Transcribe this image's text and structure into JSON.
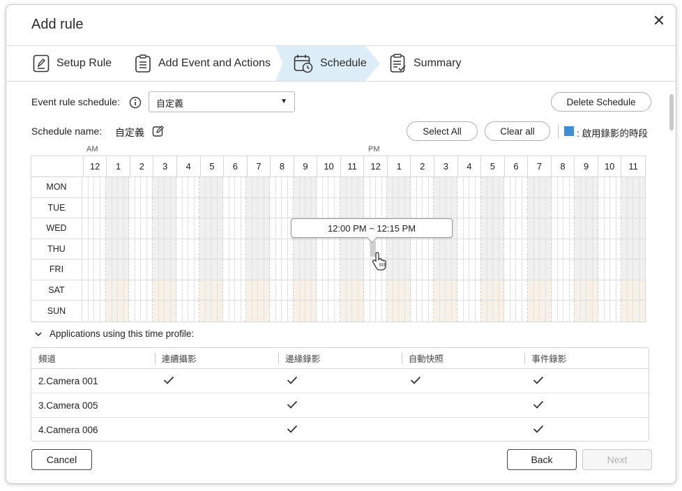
{
  "dialog": {
    "title": "Add rule",
    "close_icon": "close-icon"
  },
  "steps": [
    {
      "label": "Setup Rule",
      "icon": "edit-document-icon"
    },
    {
      "label": "Add Event and Actions",
      "icon": "clipboard-list-icon"
    },
    {
      "label": "Schedule",
      "icon": "calendar-clock-icon",
      "active": true
    },
    {
      "label": "Summary",
      "icon": "checklist-document-icon"
    }
  ],
  "schedule": {
    "rule_schedule_label": "Event rule schedule:",
    "selected": "自定義",
    "delete_label": "Delete Schedule",
    "name_label": "Schedule name:",
    "name_value": "自定義",
    "select_all_label": "Select All",
    "clear_all_label": "Clear all",
    "legend_label": ": 啟用錄影的時段",
    "legend_color": "#3d8ed6",
    "am": "AM",
    "pm": "PM",
    "hours": [
      "12",
      "1",
      "2",
      "3",
      "4",
      "5",
      "6",
      "7",
      "8",
      "9",
      "10",
      "11",
      "12",
      "1",
      "2",
      "3",
      "4",
      "5",
      "6",
      "7",
      "8",
      "9",
      "10",
      "11"
    ],
    "days": [
      "MON",
      "TUE",
      "WED",
      "THU",
      "FRI",
      "SAT",
      "SUN"
    ],
    "tooltip": "12:00 PM ~ 12:15 PM"
  },
  "apps": {
    "header": "Applications using this time profile:",
    "columns": [
      "頻道",
      "連續攝影",
      "邊緣錄影",
      "自動快照",
      "事件錄影"
    ],
    "rows": [
      {
        "name": "2.Camera 001",
        "checks": [
          true,
          true,
          true,
          true
        ]
      },
      {
        "name": "3.Camera 005",
        "checks": [
          false,
          true,
          false,
          true
        ]
      },
      {
        "name": "4.Camera 006",
        "checks": [
          false,
          true,
          false,
          true
        ]
      }
    ]
  },
  "footer": {
    "cancel": "Cancel",
    "back": "Back",
    "next": "Next"
  }
}
